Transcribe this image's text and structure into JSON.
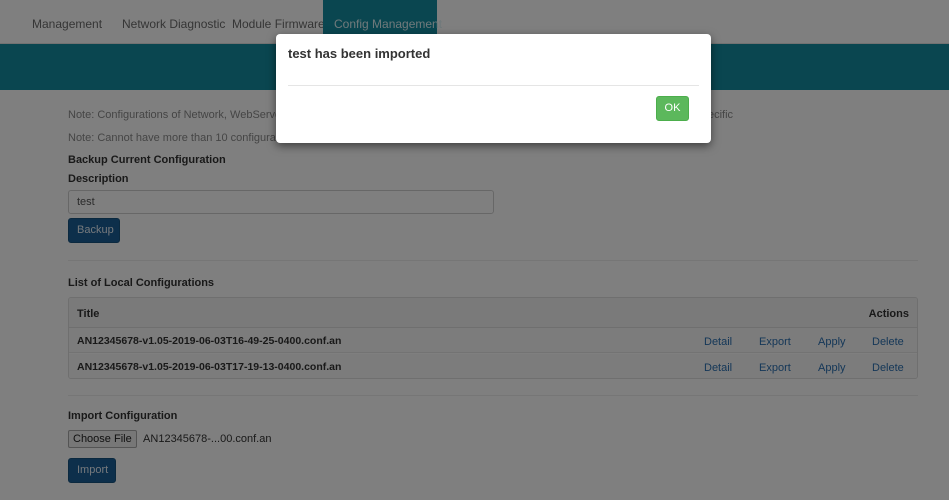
{
  "tabs": [
    {
      "label": "Management"
    },
    {
      "label": "Network Diagnostic"
    },
    {
      "label": "Module Firmware"
    },
    {
      "label": "Config Management"
    }
  ],
  "colors": {
    "accent": "#158ca0",
    "primary_button": "#1b5f96",
    "ok_button": "#5cb85c",
    "link": "#2a6fb0"
  },
  "notes": {
    "note1": "Note: Configurations of Network, WebServer,",
    "note1_tail": "ecific",
    "note2": "Note: Cannot have more than 10 configuration"
  },
  "backup": {
    "heading": "Backup Current Configuration",
    "description_label": "Description",
    "description_value": "test",
    "button_label": "Backup"
  },
  "list": {
    "heading": "List of Local Configurations",
    "col_title": "Title",
    "col_actions": "Actions",
    "rows": [
      {
        "title": "AN12345678-v1.05-2019-06-03T16-49-25-0400.conf.an",
        "detail": "Detail",
        "export": "Export",
        "apply": "Apply",
        "delete": "Delete"
      },
      {
        "title": "AN12345678-v1.05-2019-06-03T17-19-13-0400.conf.an",
        "detail": "Detail",
        "export": "Export",
        "apply": "Apply",
        "delete": "Delete"
      }
    ]
  },
  "import": {
    "heading": "Import Configuration",
    "choose_label": "Choose File",
    "file_name": "AN12345678-...00.conf.an",
    "button_label": "Import"
  },
  "modal": {
    "message": "test has been imported",
    "ok_label": "OK"
  }
}
